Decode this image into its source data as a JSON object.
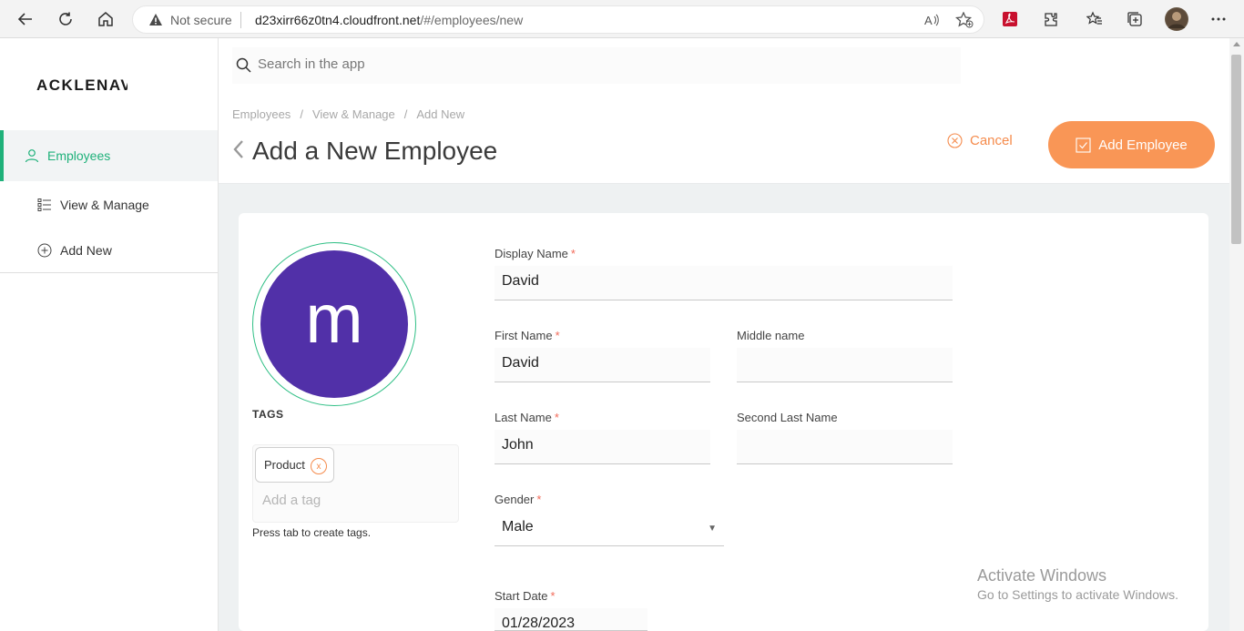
{
  "browser": {
    "not_secure": "Not secure",
    "url_host": "d23xirr66z0tn4.cloudfront.net",
    "url_path": "/#/employees/new"
  },
  "sidebar": {
    "logo": "ACKLENAVE",
    "items": [
      {
        "label": "Employees",
        "icon": "person-icon"
      },
      {
        "label": "View & Manage",
        "icon": "list-icon"
      },
      {
        "label": "Add New",
        "icon": "plus-circle-icon"
      }
    ]
  },
  "header": {
    "search_placeholder": "Search in the app",
    "breadcrumbs": [
      "Employees",
      "View & Manage",
      "Add New"
    ],
    "title": "Add a New Employee",
    "cancel_label": "Cancel",
    "add_label": "Add Employee"
  },
  "colors": {
    "accent_green": "#1fb17a",
    "accent_orange": "#f99656",
    "avatar_bg": "#5130a8"
  },
  "profile": {
    "avatar_letter": "m",
    "tags_title": "TAGS",
    "tags": [
      "Product"
    ],
    "tag_remove": "x",
    "tag_placeholder": "Add a tag",
    "tags_hint": "Press tab to create tags."
  },
  "form": {
    "display_name": {
      "label": "Display Name",
      "value": "David",
      "required": "*"
    },
    "first_name": {
      "label": "First Name",
      "value": "David",
      "required": "*"
    },
    "middle_name": {
      "label": "Middle name",
      "value": ""
    },
    "last_name": {
      "label": "Last Name",
      "value": "John",
      "required": "*"
    },
    "second_last_name": {
      "label": "Second Last Name",
      "value": ""
    },
    "gender": {
      "label": "Gender",
      "value": "Male",
      "required": "*"
    },
    "start_date": {
      "label": "Start Date",
      "value": "01/28/2023",
      "required": "*"
    }
  },
  "watermark": {
    "line1": "Activate Windows",
    "line2": "Go to Settings to activate Windows."
  }
}
